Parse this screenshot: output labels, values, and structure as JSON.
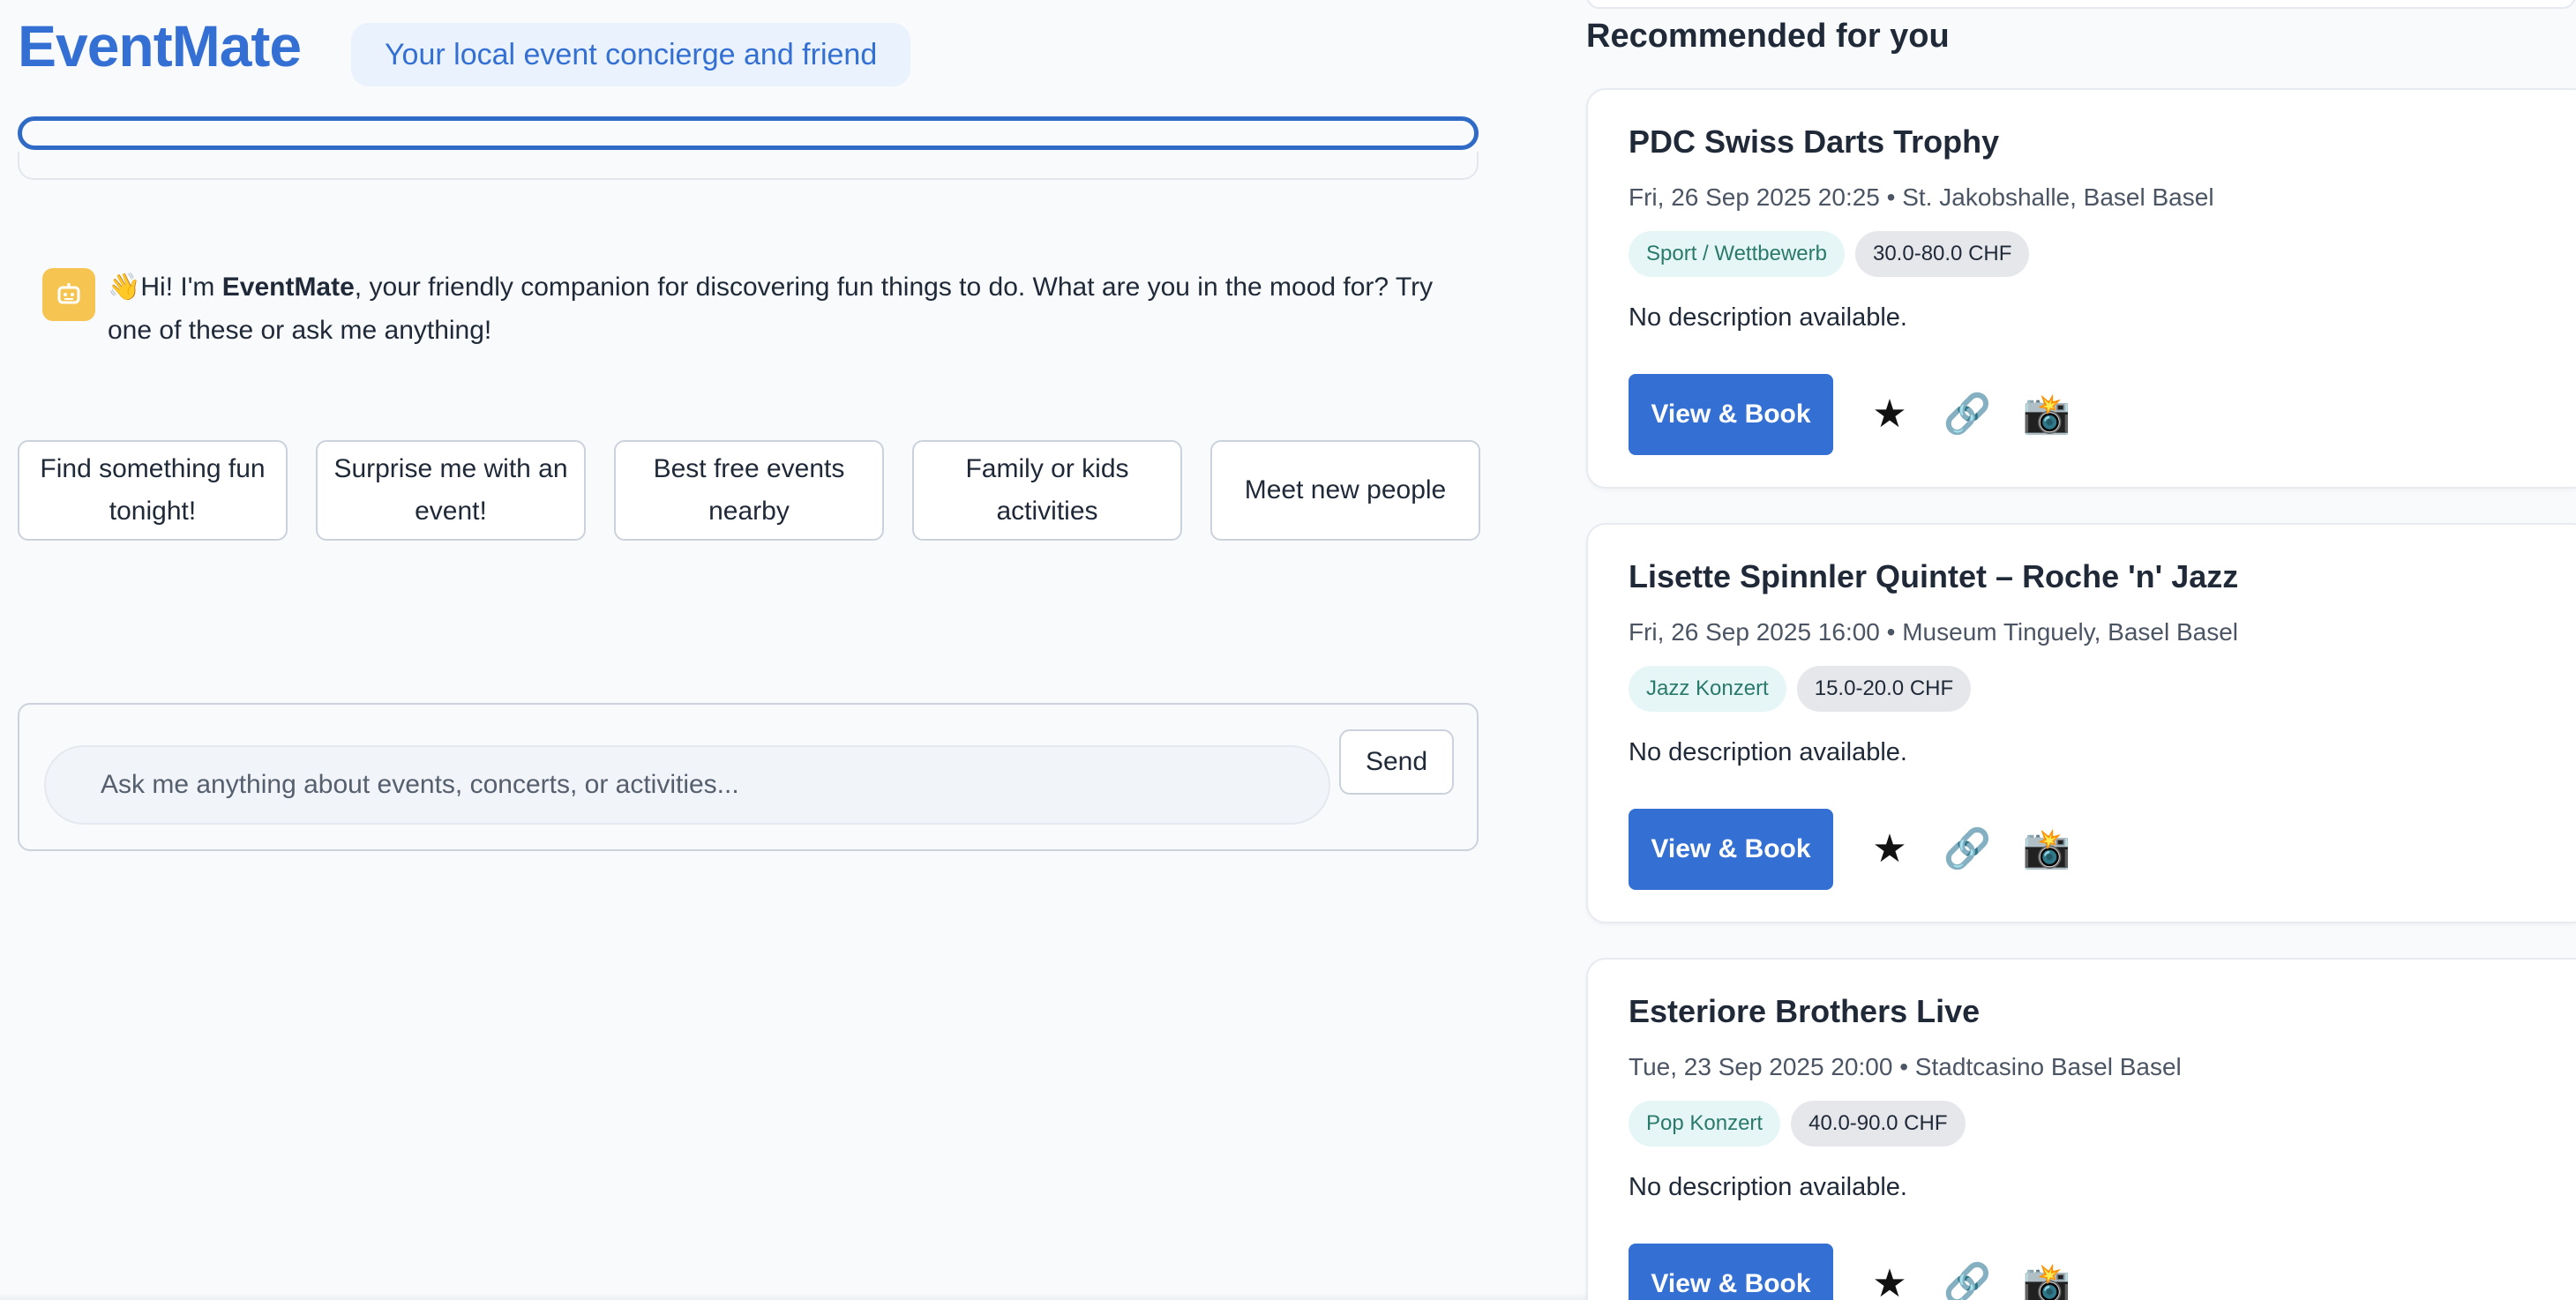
{
  "brand": {
    "name": "EventMate",
    "tagline": "Your local event concierge and friend"
  },
  "chat": {
    "greeting_emoji": "👋",
    "greeting_prefix": "Hi! I'm ",
    "greeting_name": "EventMate",
    "greeting_suffix": ", your friendly companion for discovering fun things to do. What are you in the mood for? Try one of these or ask me anything!",
    "suggestions": [
      "Find something fun tonight!",
      "Surprise me with an event!",
      "Best free events nearby",
      "Family or kids activities",
      "Meet new people"
    ],
    "input_placeholder": "Ask me anything about events, concerts, or activities...",
    "send_label": "Send"
  },
  "recommendations": {
    "heading": "Recommended for you",
    "events": [
      {
        "title": "PDC Swiss Darts Trophy",
        "meta": "Fri, 26 Sep 2025 20:25 • St. Jakobshalle, Basel Basel",
        "category": "Sport / Wettbewerb",
        "price": "30.0-80.0 CHF",
        "description": "No description available.",
        "book_label": "View & Book"
      },
      {
        "title": "Lisette Spinnler Quintet – Roche 'n' Jazz",
        "meta": "Fri, 26 Sep 2025 16:00 • Museum Tinguely, Basel Basel",
        "category": "Jazz Konzert",
        "price": "15.0-20.0 CHF",
        "description": "No description available.",
        "book_label": "View & Book"
      },
      {
        "title": "Esteriore Brothers Live",
        "meta": "Tue, 23 Sep 2025 20:00 • Stadtcasino Basel Basel",
        "category": "Pop Konzert",
        "price": "40.0-90.0 CHF",
        "description": "No description available.",
        "book_label": "View & Book"
      }
    ],
    "action_icons": {
      "favorite": "★",
      "share": "🔗",
      "photo": "📸"
    }
  },
  "colors": {
    "brand": "#3470d4",
    "background": "#f8fafc",
    "bot_avatar": "#f6c451",
    "category_tag_bg": "#e6f6f7",
    "category_tag_text": "#2a7a6c",
    "price_tag_bg": "#e5e7eb"
  }
}
